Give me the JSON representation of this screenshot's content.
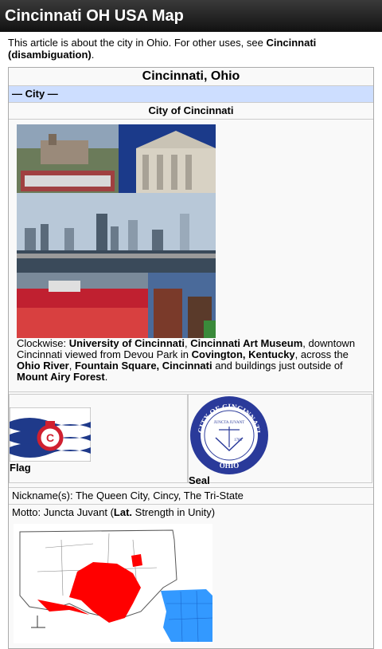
{
  "header": {
    "title": "Cincinnati OH USA Map"
  },
  "hatnote": {
    "text": "This article is about the city in Ohio. For other uses, see ",
    "link": "Cincinnati (disambiguation)",
    "end": "."
  },
  "infobox": {
    "title": "Cincinnati, Ohio",
    "city_label": "— City —",
    "subtitle": "City of Cincinnati",
    "caption": {
      "p1": "Clockwise: ",
      "l1": "University of Cincinnati",
      "p2": ", ",
      "l2": "Cincinnati Art Museum",
      "p3": ", downtown Cincinnati viewed from Devou Park in ",
      "l3": "Covington, Kentucky",
      "p4": ", across the ",
      "l4": "Ohio River",
      "p5": ", ",
      "l5": "Fountain Square, Cincinnati",
      "p6": " and buildings just outside of ",
      "l6": "Mount Airy Forest",
      "p7": "."
    },
    "flag_label": "Flag",
    "seal_label": "Seal",
    "seal_text_top": "CITY OF CINCINNATI",
    "seal_text_bottom": "OHIO",
    "seal_motto": "JUNCTA JUVANT",
    "seal_year": "1788",
    "nicknames": "Nickname(s): The Queen City, Cincy, The Tri-State",
    "motto_prefix": "Motto: Juncta Juvant (",
    "motto_lat": "Lat.",
    "motto_rest": " Strength in Unity)"
  },
  "colors": {
    "header_bg": "#1a1a1a",
    "city_bar": "#cddeff",
    "map_red": "#ff0000",
    "map_blue": "#3399ff",
    "flag_blue": "#1f3a8a",
    "flag_red": "#d02030"
  }
}
